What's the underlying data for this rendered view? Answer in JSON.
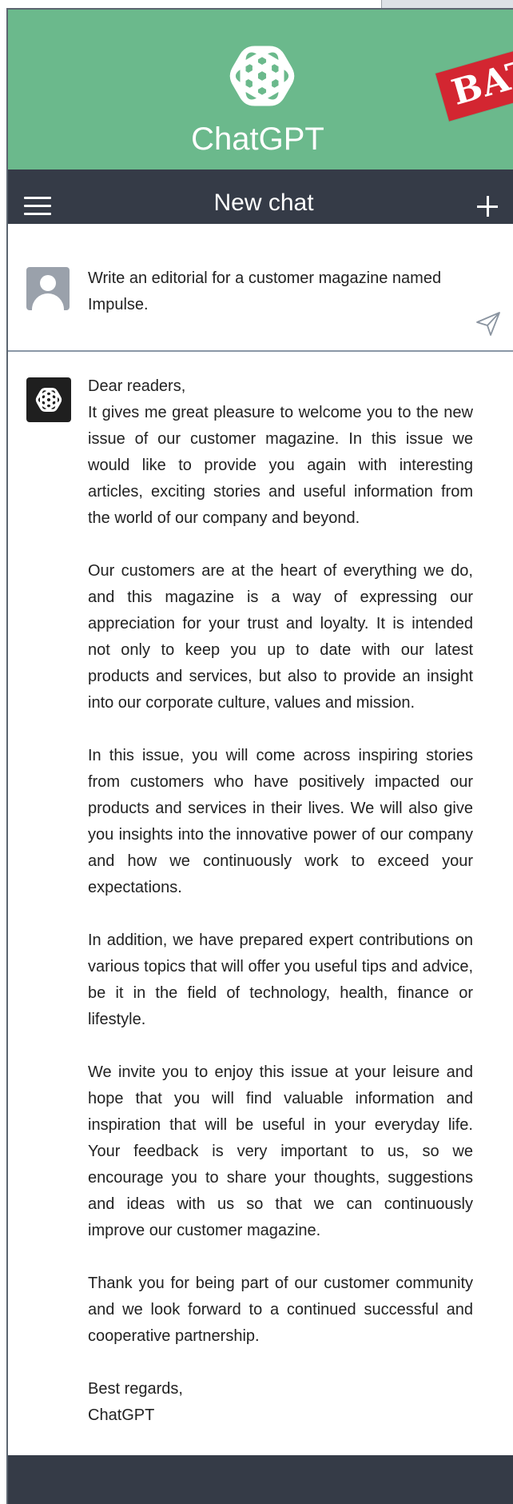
{
  "header": {
    "app_title": "ChatGPT",
    "logo_icon": "chatgpt-logo-icon",
    "background_color": "#6bb98c",
    "stamp_text": "BAT",
    "stamp_color": "#d32631"
  },
  "navbar": {
    "title": "New chat",
    "menu_icon": "hamburger-menu-icon",
    "new_chat_icon": "plus-icon",
    "background_color": "#353b47"
  },
  "prompt": {
    "user_avatar_icon": "user-avatar-icon",
    "text": "Write an editorial for a customer magazine named Impulse.",
    "send_icon": "send-icon"
  },
  "response": {
    "assistant_avatar_icon": "chatgpt-avatar-icon",
    "salutation": "Dear readers,",
    "paragraphs": [
      "It gives me great pleasure to welcome you to the new issue of our customer magazine. In this issue we would like to provide you again with interesting articles, exciting stories and useful information from the world of our company and beyond.",
      "Our customers are at the heart of everything we do, and this magazine is a way of expressing our appreciation for your trust and loyalty. It is intended not only to keep you up to date with our latest products and services, but also to provide an insight into our corporate culture, values and mission.",
      "In this issue, you will come across inspiring stories from customers who have positively impacted our products and services in their lives. We will also give you insights into the innovative power of our company and how we continuously work to exceed your expectations.",
      "In addition, we have prepared expert contributions on various topics that will offer you useful tips and advice, be it in the field of technology, health, finance or lifestyle.",
      "We invite you to enjoy this issue at your leisure and hope that you will find valuable information and inspiration that will be useful in your everyday life. Your feedback is very important to us, so we encourage you to share your thoughts, suggestions and ideas with us so that we can continuously improve our customer magazine.",
      "Thank you for being part of our customer community and we look forward to a continued successful and cooperative partnership."
    ],
    "closing": "Best regards,",
    "signature": "ChatGPT"
  },
  "footer": {
    "background_color": "#353b47"
  }
}
